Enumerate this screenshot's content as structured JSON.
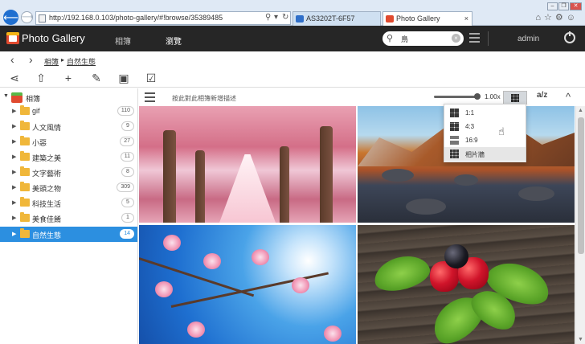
{
  "browser": {
    "url": "http://192.168.0.103/photo-gallery/#!browse/35389485",
    "tabs": [
      {
        "label": "AS3202T-6F57",
        "color": "#2f6fc9",
        "close": ""
      },
      {
        "label": "Photo Gallery",
        "color": "#e04a2f",
        "close": "×"
      }
    ],
    "controls": {
      "search_glyph": "⚲",
      "dropdown_glyph": "▾",
      "refresh_glyph": "↻"
    },
    "toolbar_glyphs": "⌂☆⚙☺",
    "window_controls": [
      "–",
      "❐",
      "✕"
    ]
  },
  "app": {
    "title": "Photo Gallery",
    "menu_album": "相簿",
    "menu_browse": "瀏覽",
    "search_value": "鳥",
    "search_clear": "×",
    "user": "admin"
  },
  "breadcrumb": {
    "back": "‹",
    "forward": "›",
    "root": "相簿",
    "separator": "▸",
    "current": "自然生態"
  },
  "toolbar": {
    "icons": [
      "share-icon",
      "upload-icon",
      "add-icon",
      "edit-icon",
      "slideshow-icon",
      "select-icon"
    ],
    "glyphs": [
      "⋖",
      "⇧",
      "+",
      "✎",
      "▣",
      "☑"
    ]
  },
  "sidebar": {
    "root_label": "相簿",
    "root_caret": "▼",
    "item_caret": "▶",
    "items": [
      {
        "label": "gif",
        "count": "110"
      },
      {
        "label": "人文風情",
        "count": "9"
      },
      {
        "label": "小惡",
        "count": "27"
      },
      {
        "label": "建築之美",
        "count": "11"
      },
      {
        "label": "文字藝術",
        "count": "8"
      },
      {
        "label": "美頭之物",
        "count": "309"
      },
      {
        "label": "科技生活",
        "count": "5"
      },
      {
        "label": "美食佳餚",
        "count": "1"
      },
      {
        "label": "自然生態",
        "count": "14",
        "selected": true
      }
    ]
  },
  "content": {
    "description_placeholder": "按此對此相簿新增描述",
    "zoom": "1.00x",
    "sort_label": "a/z",
    "collapse": "^"
  },
  "dropdown": {
    "options": [
      "1:1",
      "4:3",
      "16:9",
      "相片牆"
    ]
  },
  "cursor_glyph": "☝",
  "scroll_glyphs": {
    "up": "▲",
    "down": "▼"
  }
}
